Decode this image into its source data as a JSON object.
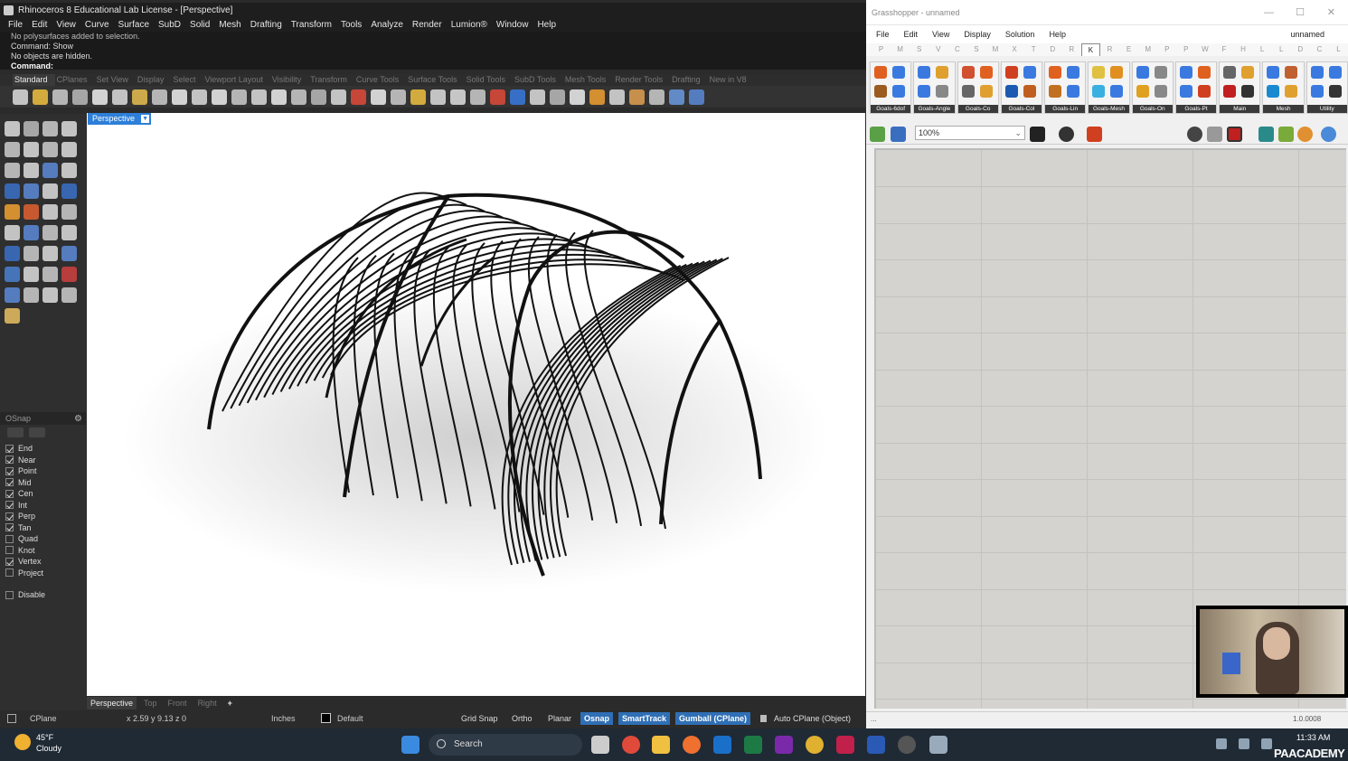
{
  "rhino": {
    "title": "Rhinoceros 8 Educational Lab License - [Perspective]",
    "menu": [
      "File",
      "Edit",
      "View",
      "Curve",
      "Surface",
      "SubD",
      "Solid",
      "Mesh",
      "Drafting",
      "Transform",
      "Tools",
      "Analyze",
      "Render",
      "Lumion®",
      "Window",
      "Help"
    ],
    "command_history": [
      "No polysurfaces added to selection.",
      "Command: Show",
      "No objects are hidden."
    ],
    "command_prompt": "Command:",
    "toolbar_tabs": [
      "Standard",
      "CPlanes",
      "Set View",
      "Display",
      "Select",
      "Viewport Layout",
      "Visibility",
      "Transform",
      "Curve Tools",
      "Surface Tools",
      "Solid Tools",
      "SubD Tools",
      "Mesh Tools",
      "Render Tools",
      "Drafting",
      "New in V8"
    ],
    "viewport_tab": "Perspective",
    "viewport_tabs": [
      "Perspective",
      "Top",
      "Front",
      "Right"
    ],
    "add_tab": "+",
    "osnap": {
      "title": "OSnap",
      "items": [
        {
          "label": "End",
          "checked": true
        },
        {
          "label": "Near",
          "checked": true
        },
        {
          "label": "Point",
          "checked": true
        },
        {
          "label": "Mid",
          "checked": true
        },
        {
          "label": "Cen",
          "checked": true
        },
        {
          "label": "Int",
          "checked": true
        },
        {
          "label": "Perp",
          "checked": true
        },
        {
          "label": "Tan",
          "checked": true
        },
        {
          "label": "Quad",
          "checked": false
        },
        {
          "label": "Knot",
          "checked": false
        },
        {
          "label": "Vertex",
          "checked": true
        },
        {
          "label": "Project",
          "checked": false
        }
      ],
      "disable": {
        "label": "Disable",
        "checked": false
      }
    },
    "status": {
      "cplane": "CPlane",
      "coords": "x 2.59  y 9.13  z 0",
      "units": "Inches",
      "layer": "Default",
      "grid_snap": "Grid Snap",
      "ortho": "Ortho",
      "planar": "Planar",
      "osnap": "Osnap",
      "smarttrack": "SmartTrack",
      "gumball": "Gumball (CPlane)",
      "auto_cplane": "Auto CPlane (Object)"
    }
  },
  "grasshopper": {
    "title": "Grasshopper - unnamed",
    "menu": [
      "File",
      "Edit",
      "View",
      "Display",
      "Solution",
      "Help"
    ],
    "document": "unnamed",
    "tabs": [
      "P",
      "M",
      "S",
      "V",
      "C",
      "S",
      "M",
      "X",
      "T",
      "D",
      "R",
      "K",
      "R",
      "E",
      "M",
      "P",
      "P",
      "W",
      "F",
      "H",
      "L",
      "L",
      "D",
      "C",
      "L"
    ],
    "active_tab_index": 11,
    "groups": [
      "Goals-6dof",
      "Goals-Angle",
      "Goals-Co",
      "Goals-Col",
      "Goals-Lin",
      "Goals-Mesh",
      "Goals-On",
      "Goals-Pt",
      "Main",
      "Mesh",
      "Utility"
    ],
    "zoom": "100%",
    "status_left": "...",
    "status_right": "1.0.0008"
  },
  "taskbar": {
    "temp": "45°F",
    "condition": "Cloudy",
    "search": "Search",
    "time": "11:33 AM",
    "brand": "PAACADEMY"
  },
  "colors": {
    "accent": "#2d7fd8",
    "status_highlight": "#2f6fb5",
    "canvas": "#d5d3cf"
  }
}
